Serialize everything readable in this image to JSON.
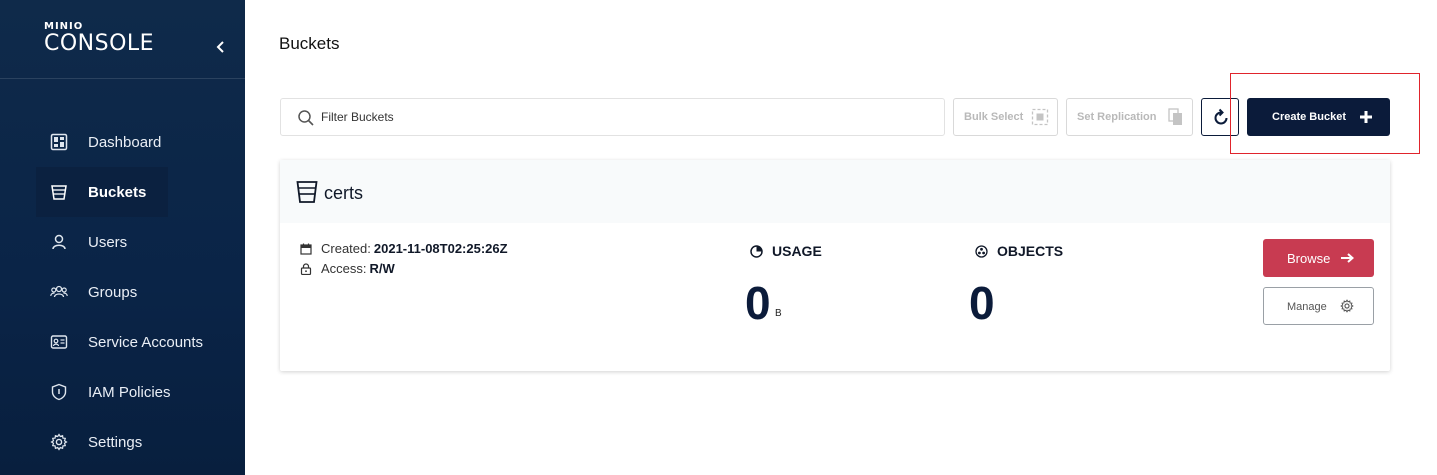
{
  "brand": {
    "top": "MINIO",
    "main": "CONSOLE"
  },
  "sidebar": {
    "items": [
      {
        "label": "Dashboard",
        "icon": "dashboard-icon",
        "active": false
      },
      {
        "label": "Buckets",
        "icon": "bucket-icon",
        "active": true
      },
      {
        "label": "Users",
        "icon": "user-icon",
        "active": false
      },
      {
        "label": "Groups",
        "icon": "groups-icon",
        "active": false
      },
      {
        "label": "Service Accounts",
        "icon": "service-accounts-icon",
        "active": false
      },
      {
        "label": "IAM Policies",
        "icon": "shield-icon",
        "active": false
      },
      {
        "label": "Settings",
        "icon": "gear-icon",
        "active": false
      }
    ]
  },
  "header": {
    "title": "Buckets"
  },
  "toolbar": {
    "filter_placeholder": "Filter Buckets",
    "bulk_select": "Bulk Select",
    "set_replication": "Set Replication",
    "create_bucket": "Create Bucket"
  },
  "bucket": {
    "name": "certs",
    "created_label": "Created:",
    "created_value": "2021-11-08T02:25:26Z",
    "access_label": "Access:",
    "access_value": "R/W",
    "usage_label": "USAGE",
    "usage_value": "0",
    "usage_unit": "B",
    "objects_label": "OBJECTS",
    "objects_value": "0",
    "browse_label": "Browse",
    "manage_label": "Manage"
  },
  "colors": {
    "sidebar_bg": "#0a2447",
    "primary": "#0b1b3a",
    "browse": "#c83b51",
    "highlight": "#e0242c"
  }
}
